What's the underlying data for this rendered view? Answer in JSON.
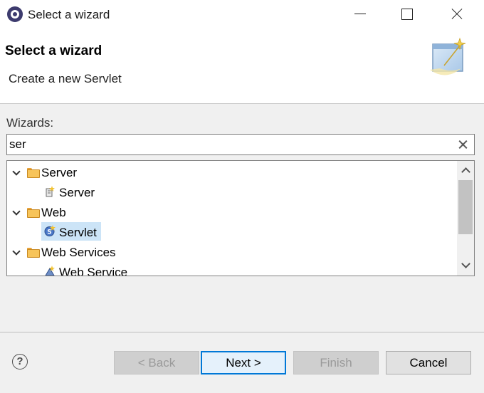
{
  "window": {
    "title": "Select a wizard",
    "controls": {
      "minimize": "minimize-icon",
      "maximize": "maximize-icon",
      "close": "close-icon"
    }
  },
  "header": {
    "title": "Select a wizard",
    "description": "Create a new Servlet",
    "graphic": "wizard-banner-icon"
  },
  "filter": {
    "label": "Wizards:",
    "value": "ser"
  },
  "tree": {
    "items": [
      {
        "label": "Server",
        "type": "folder",
        "expanded": true
      },
      {
        "label": "Server",
        "type": "leaf",
        "icon": "new-server-icon"
      },
      {
        "label": "Web",
        "type": "folder",
        "expanded": true
      },
      {
        "label": "Servlet",
        "type": "leaf",
        "icon": "servlet-icon",
        "selected": true
      },
      {
        "label": "Web Services",
        "type": "folder",
        "expanded": true
      },
      {
        "label": "Web Service",
        "type": "leaf",
        "icon": "web-service-icon"
      }
    ]
  },
  "buttons": {
    "back": "< Back",
    "next": "Next >",
    "finish": "Finish",
    "cancel": "Cancel",
    "help": "?"
  },
  "colors": {
    "selection": "#cce4f7",
    "default_button_border": "#0078d7",
    "folder": "#f7c45a"
  }
}
